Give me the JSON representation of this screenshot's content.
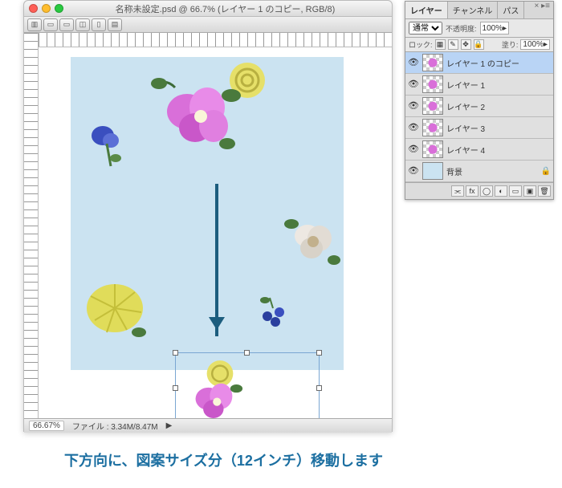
{
  "window": {
    "title": "名称未設定.psd @ 66.7% (レイヤー 1  のコピー, RGB/8)"
  },
  "statusbar": {
    "zoom": "66.67%",
    "fileinfo": "ファイル : 3.34M/8.47M"
  },
  "panel": {
    "tabs": {
      "layers": "レイヤー",
      "channels": "チャンネル",
      "paths": "パス"
    },
    "blend_mode": "通常",
    "opacity_label": "不透明度:",
    "opacity_value": "100%",
    "lock_label": "ロック:",
    "fill_label": "塗り:",
    "fill_value": "100%",
    "layers": [
      {
        "name": "レイヤー 1  のコピー",
        "selected": true,
        "bg": false
      },
      {
        "name": "レイヤー 1",
        "selected": false,
        "bg": false
      },
      {
        "name": "レイヤー 2",
        "selected": false,
        "bg": false
      },
      {
        "name": "レイヤー 3",
        "selected": false,
        "bg": false
      },
      {
        "name": "レイヤー 4",
        "selected": false,
        "bg": false
      },
      {
        "name": "背景",
        "selected": false,
        "bg": true
      }
    ]
  },
  "caption": "下方向に、図案サイズ分（12インチ）移動します"
}
